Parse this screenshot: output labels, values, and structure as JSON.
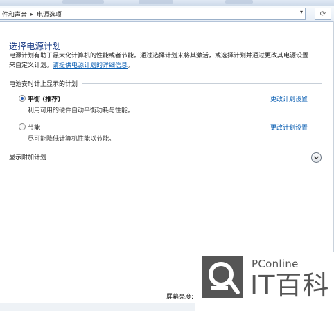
{
  "address_bar": {
    "crumbs": [
      "件和声音",
      "电源选项"
    ],
    "refresh_icon": "refresh-icon",
    "dropdown_icon": "chevron-down-icon"
  },
  "page": {
    "title": "选择电源计划",
    "desc_line1": "电源计划有助于最大化计算机的性能或者节能。通过选择计划来将其激活，或选择计划并通过更改其电源设置",
    "desc_line2_prefix": "来自定义计划。",
    "desc_link": "请提供电源计划的详细信息",
    "desc_line2_suffix": "。"
  },
  "battery_section": {
    "header": "电池安时计上显示的计划",
    "plans": [
      {
        "name": "平衡 (推荐)",
        "description": "利用可用的硬件自动平衡功耗与性能。",
        "selected": true,
        "change_link": "更改计划设置"
      },
      {
        "name": "节能",
        "description": "尽可能降低计算机性能以节能。",
        "selected": false,
        "change_link": "更改计划设置"
      }
    ]
  },
  "additional": {
    "label": "显示附加计划",
    "expand_icon": "expand-chevron-icon"
  },
  "footer": {
    "label": "屏幕亮度:"
  },
  "watermark": {
    "brand_small": "PConline",
    "brand_big": "IT百科"
  },
  "colors": {
    "title": "#1b3c86",
    "link": "#0b5fb3",
    "watermark": "#555555"
  }
}
